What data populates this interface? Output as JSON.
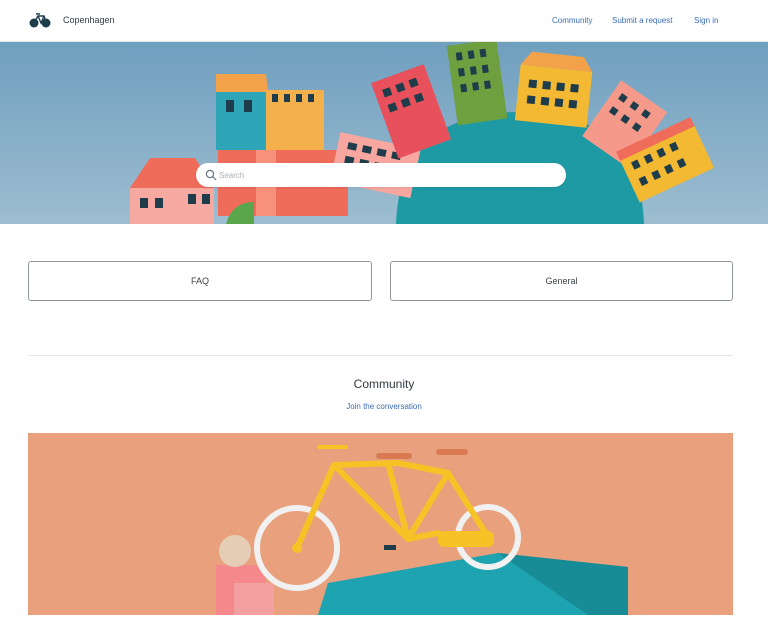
{
  "header": {
    "brand": "Copenhagen",
    "logo_icon": "bicycle-icon",
    "nav": {
      "community": "Community",
      "submit_request": "Submit a request",
      "sign_in": "Sign in"
    }
  },
  "hero": {
    "search_placeholder": "Search",
    "search_icon": "search-icon"
  },
  "categories": [
    {
      "label": "FAQ"
    },
    {
      "label": "General"
    }
  ],
  "community": {
    "title": "Community",
    "link": "Join the conversation"
  },
  "colors": {
    "accent": "#3a6db5",
    "hero_sky": "#7ea8c4",
    "community_bg": "#e8a07d"
  }
}
